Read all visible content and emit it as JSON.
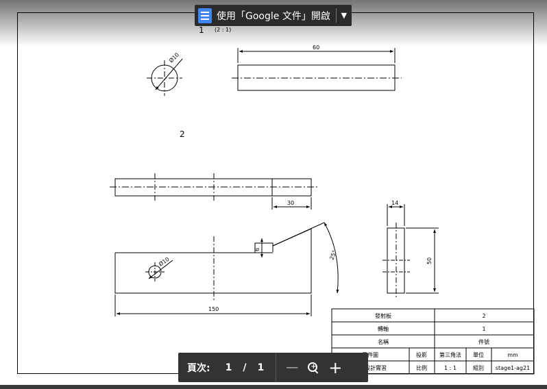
{
  "toolbar": {
    "open_with_label": "使用「Google 文件」開啟",
    "doc_icon": "google-docs-icon",
    "dropdown_icon": "caret-down-icon"
  },
  "drawing": {
    "view1_number": "1",
    "view1_scale": "(2 : 1)",
    "view2_number": "2",
    "dims": {
      "d1": "Ø10",
      "d2": "60",
      "d3": "30",
      "d4": "14",
      "d5": "6",
      "d6": "Ø10",
      "d7": "25°",
      "d8": "50",
      "d9": "150"
    }
  },
  "title_block": {
    "rows": [
      [
        "發射板",
        "2"
      ],
      [
        "轉軸",
        "1"
      ],
      [
        "名稱",
        "件號"
      ]
    ],
    "row4": [
      "零件圖",
      "投影",
      "第三角法",
      "單位",
      "mm"
    ],
    "row5": [
      "產品設計實習",
      "比例",
      "1 : 1",
      "組別",
      "stage1-ag21"
    ]
  },
  "pager": {
    "label": "頁次:",
    "current": "1",
    "slash": "/",
    "total": "1",
    "zoom_out": "—",
    "zoom_in": "+",
    "zoom_icon": "magnifier-icon"
  }
}
